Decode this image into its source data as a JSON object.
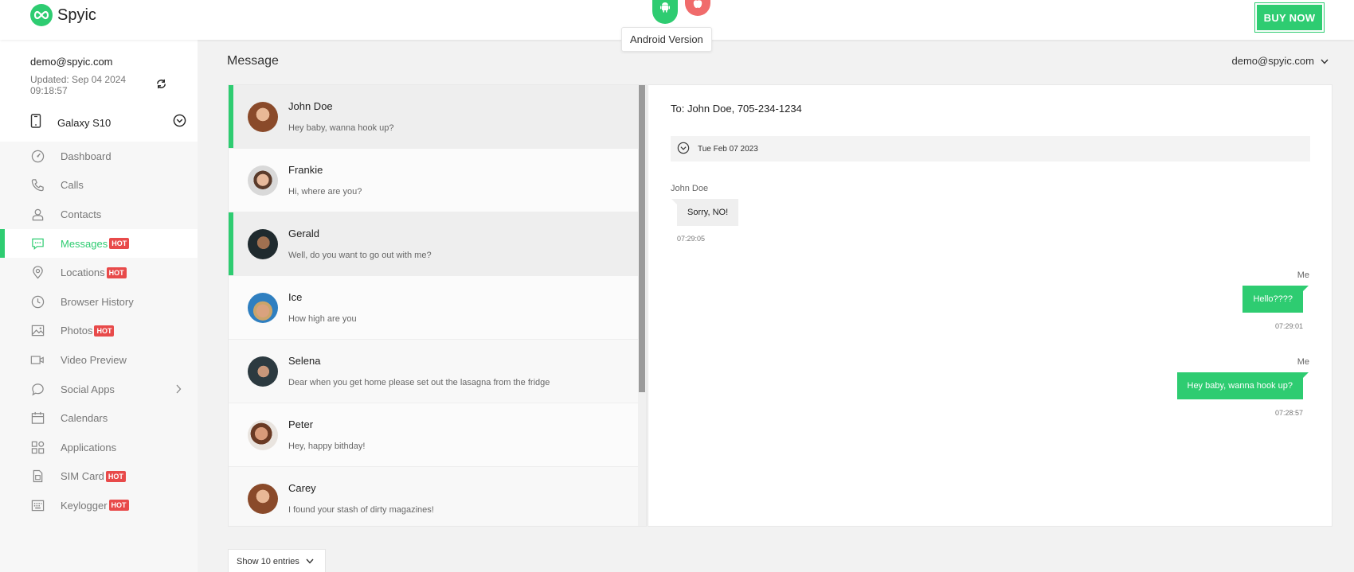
{
  "header": {
    "brand": "Spyic",
    "tooltip": "Android Version",
    "buy_label": "BUY NOW",
    "accent": "#2ecc71"
  },
  "sidebar": {
    "email": "demo@spyic.com",
    "updated": "Updated: Sep 04 2024 09:18:57",
    "device": "Galaxy S10",
    "items": [
      {
        "label": "Dashboard",
        "icon": "dashboard-icon"
      },
      {
        "label": "Calls",
        "icon": "phone-icon"
      },
      {
        "label": "Contacts",
        "icon": "contact-icon"
      },
      {
        "label": "Messages",
        "icon": "message-icon",
        "hot": "HOT",
        "active": true
      },
      {
        "label": "Locations",
        "icon": "location-icon",
        "hot": "HOT"
      },
      {
        "label": "Browser History",
        "icon": "clock-icon"
      },
      {
        "label": "Photos",
        "icon": "image-icon",
        "hot": "HOT"
      },
      {
        "label": "Video Preview",
        "icon": "video-icon"
      },
      {
        "label": "Social Apps",
        "icon": "chat-bubble-icon"
      },
      {
        "label": "Calendars",
        "icon": "calendar-icon"
      },
      {
        "label": "Applications",
        "icon": "apps-icon"
      },
      {
        "label": "SIM Card",
        "icon": "sim-icon",
        "hot": "HOT"
      },
      {
        "label": "Keylogger",
        "icon": "keyboard-icon",
        "hot": "HOT"
      }
    ]
  },
  "main": {
    "title": "Message",
    "user_menu": "demo@spyic.com",
    "conversations": [
      {
        "name": "John Doe",
        "preview": "Hey baby, wanna hook up?",
        "active": true
      },
      {
        "name": "Frankie",
        "preview": "Hi, where are you?"
      },
      {
        "name": "Gerald",
        "preview": "Well, do you want to go out with me?",
        "active": true
      },
      {
        "name": "Ice",
        "preview": "How high are you"
      },
      {
        "name": "Selena",
        "preview": "Dear when you get home please set out the lasagna from the fridge"
      },
      {
        "name": "Peter",
        "preview": "Hey, happy bithday!"
      },
      {
        "name": "Carey",
        "preview": "I found your stash of dirty magazines!"
      }
    ],
    "entries_label": "Show 10 entries"
  },
  "chat": {
    "to": "To: John Doe, 705-234-1234",
    "date": "Tue Feb 07 2023",
    "messages": [
      {
        "sender": "John Doe",
        "text": "Sorry, NO!",
        "time": "07:29:05",
        "direction": "in"
      },
      {
        "sender": "Me",
        "text": "Hello????",
        "time": "07:29:01",
        "direction": "out"
      },
      {
        "sender": "Me",
        "text": "Hey baby, wanna hook up?",
        "time": "07:28:57",
        "direction": "out"
      }
    ]
  }
}
